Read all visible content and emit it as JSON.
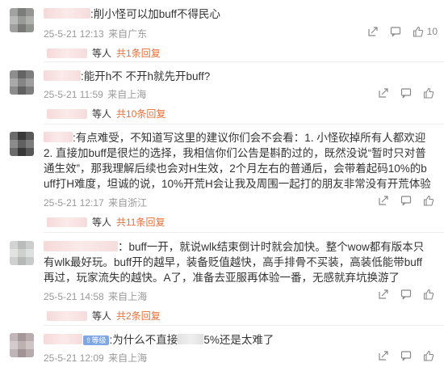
{
  "comments": [
    {
      "text": ":削小怪可以加buff不得民心",
      "date": "25-5-21 12:13",
      "location": "来自广东",
      "likes": "10",
      "and_label": "等人",
      "reply_link": "共1条回复"
    },
    {
      "text": ":能开h不  不开h就先开buff?",
      "date": "25-5-21 11:59",
      "location": "来自上海",
      "likes": "",
      "and_label": "等人",
      "reply_link": "共10条回复"
    },
    {
      "text": ":有点难受，不知道写这里的建议你们会不会看：1. 小怪砍掉所有人都欢迎 2. 直接加buff是很烂的选择，我相信你们公告是斟酌过的，既然没说“暂时只对普通生效”，那我理解后续也会对H生效，2个月左右的普通后，会带着起码10%的buff打H难度，坦诚的说，10%开荒H会让我及周围一起打的朋友非常没有开荒体验",
      "date": "25-5-21 12:17",
      "location": "来自浙江",
      "likes": "",
      "and_label": "等人",
      "reply_link": "共11条回复"
    },
    {
      "text": "：buff一开，就说wlk结束倒计时就会加快。整个wow都有版本只有wlk最好玩。buff开的越早，装备贬值越快，高手排骨不买装，高装低能带buff再过，玩家流失的越快。A了，准备去亚服再体验一番，无感就弃坑换游了",
      "date": "25-5-21 14:58",
      "location": "来自上海",
      "likes": "",
      "and_label": "等人",
      "reply_link": "共2条回复"
    },
    {
      "text_prefix": ":为什么不直接",
      "text_suffix": "5%还是太难了",
      "badge": "⇧等级",
      "date": "25-5-21 12:09",
      "location": "来自上海",
      "likes": ""
    }
  ],
  "colors": {
    "reply_link": "#e86f3a",
    "meta": "#999999",
    "text": "#333333"
  }
}
